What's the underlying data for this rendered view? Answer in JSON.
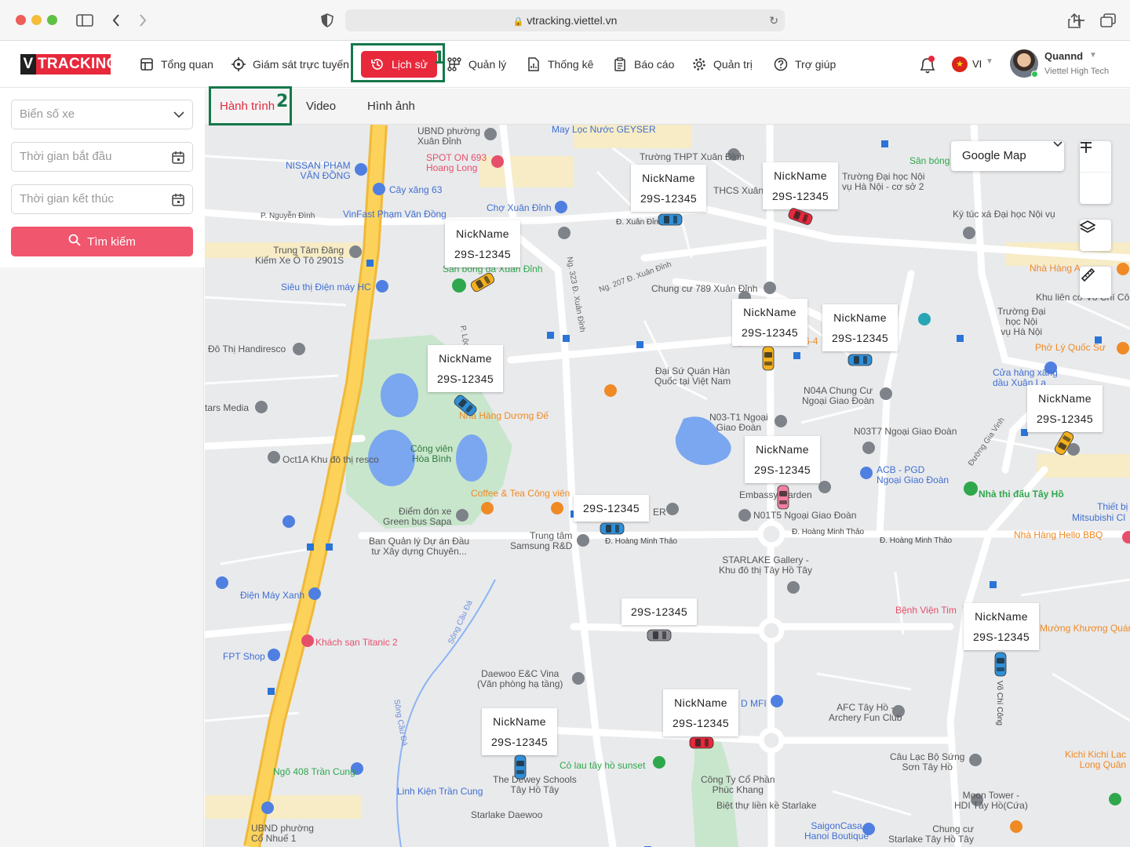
{
  "browser": {
    "url": "vtracking.viettel.vn"
  },
  "logo": {
    "v": "V",
    "text": "TRACKING"
  },
  "nav": {
    "items": [
      "Tổng quan",
      "Giám sát trực tuyến",
      "Lịch sử",
      "Quản lý",
      "Thống kê",
      "Báo cáo",
      "Quản trị",
      "Trợ giúp"
    ],
    "lang": "VI",
    "user_name": "Quannd",
    "user_org": "Viettel High Tech"
  },
  "annotations": {
    "one": "1",
    "two": "2"
  },
  "tabs": [
    "Hành trình",
    "Video",
    "Hình ảnh"
  ],
  "sidebar": {
    "plate_placeholder": "Biển số xe",
    "start_placeholder": "Thời gian bắt đầu",
    "end_placeholder": "Thời gian kết thúc",
    "search_label": "Tìm kiếm"
  },
  "map": {
    "type_selector": "Google Map",
    "vehicles": [
      {
        "nick": "NickName",
        "plate": "29S-12345",
        "color": "#2f8fd8"
      },
      {
        "nick": "NickName",
        "plate": "29S-12345",
        "color": "#e8283b"
      },
      {
        "nick": "NickName",
        "plate": "29S-12345",
        "color": "#f2b01e"
      },
      {
        "nick": "NickName",
        "plate": "29S-12345",
        "color": "#f2b01e"
      },
      {
        "nick": "NickName",
        "plate": "29S-12345",
        "color": "#2f8fd8"
      },
      {
        "nick": "NickName",
        "plate": "29S-12345",
        "color": "#2f8fd8"
      },
      {
        "nick": "NickName",
        "plate": "29S-12345",
        "color": "#f2b01e"
      },
      {
        "nick": "NickName",
        "plate": "29S-12345",
        "color": "#f07fa0"
      },
      {
        "nick": "",
        "plate": "29S-12345",
        "color": "#2f8fd8"
      },
      {
        "nick": "",
        "plate": "29S-12345",
        "color": "#8c8c94"
      },
      {
        "nick": "NickName",
        "plate": "29S-12345",
        "color": "#2f8fd8"
      },
      {
        "nick": "NickName",
        "plate": "29S-12345",
        "color": "#e8283b"
      },
      {
        "nick": "NickName",
        "plate": "29S-12345",
        "color": "#2f8fd8"
      }
    ],
    "places": [
      "UBND phường Xuân Đỉnh",
      "SPOT ON 693 Hoang Long",
      "NISSAN PHẠM VĂN ĐỒNG",
      "Cây xăng 63",
      "Chợ Xuân Đỉnh",
      "VinFast Phạm Văn Đồng",
      "P. Nguyễn Đình",
      "Trung Tâm Đăng Kiểm Xe Ô Tô 2901S",
      "Sân bóng đá Xuân Đỉnh",
      "Siêu thị Điện máy HC",
      "Trường THPT Xuân Đỉnh",
      "THCS Xuân",
      "Sân bóng",
      "Trường Đại học Nội vụ Hà Nội - cơ sở 2",
      "Ký túc xá Đại học Nội vụ",
      "Nhà Hàng A",
      "Khu liên cơ Võ Chí Công",
      "Trường Đại học Nội vụ Hà Nội",
      "Phở Lý Quốc Sư",
      "Cửa hàng xăng dầu Xuân La",
      "Chung cư 789 Xuân Đỉnh",
      "Quán Ti Divo BT6-4",
      "Đại Sứ Quán Hàn Quốc tại Việt Nam",
      "N04A Chung Cư Ngoại Giao Đoàn",
      "N03-T1 Ngoại Giao Đoàn",
      "N03T7 Ngoại Giao Đoàn",
      "ACB - PGD Ngoại Giao Đoàn",
      "Nhà thi đấu Tây Hồ",
      "Đô Thị Handiresco",
      "tars Media",
      "Nhà Hàng Dương Đế",
      "Công viên Hòa Bình",
      "Oct1A Khu đô thị resco",
      "Coffee & Tea Công viên",
      "Điểm đón xe Green bus Sapa",
      "Ban Quản lý Dự án Đầu tư Xây dựng Chuyên...",
      "Trung tâm Samsung R&D",
      "Embassy Garden",
      "N01T5 Ngoại Giao Đoàn",
      "Mitsubishi Cl",
      "Nhà Hàng Hello BBQ",
      "Điện Máy Xanh",
      "STARLAKE Gallery - Khu đô thị Tây Hồ Tây",
      "Khách sạn Titanic 2",
      "Bệnh Viện Tim",
      "Mường Khương Quán",
      "FPT Shop",
      "Daewoo E&C Vina (Văn phòng hạ tầng)",
      "AFC Tây Hồ - Archery Fun Club",
      "Cỏ lau tây hồ sunset",
      "The Dewey Schools Tây Hồ Tây",
      "Ngõ 408 Trần Cung",
      "Linh Kiện Trần Cung",
      "Câu Lạc Bộ Sứng Sơn Tây Hồ",
      "Kichi Kichi Lac Long Quân",
      "Công Ty Cổ Phần Phúc Khang",
      "Biệt thự liền kề Starlake",
      "Moon Tower - HDI Tây Hồ(Cứa)",
      "SaigonCasa Hanoi Boutique",
      "Chung cư Starlake Tây Hồ Tây",
      "Starlake Daewoo",
      "UBND phường Cổ Nhuế 1",
      "May Lọc Nước GEYSER",
      "Đ. Xuân Đỉnh",
      "Ng. 207 Đ. Xuân Đỉnh",
      "Ng. 323 Đ. Xuân Đỉnh",
      "Đ. Hoàng Minh Thảo",
      "Võ Chí Công",
      "Sông Cầu Đá",
      "Đường Gia Vinh",
      "P. Lộc",
      "Thiết bị",
      "ER",
      "D MFI"
    ]
  }
}
